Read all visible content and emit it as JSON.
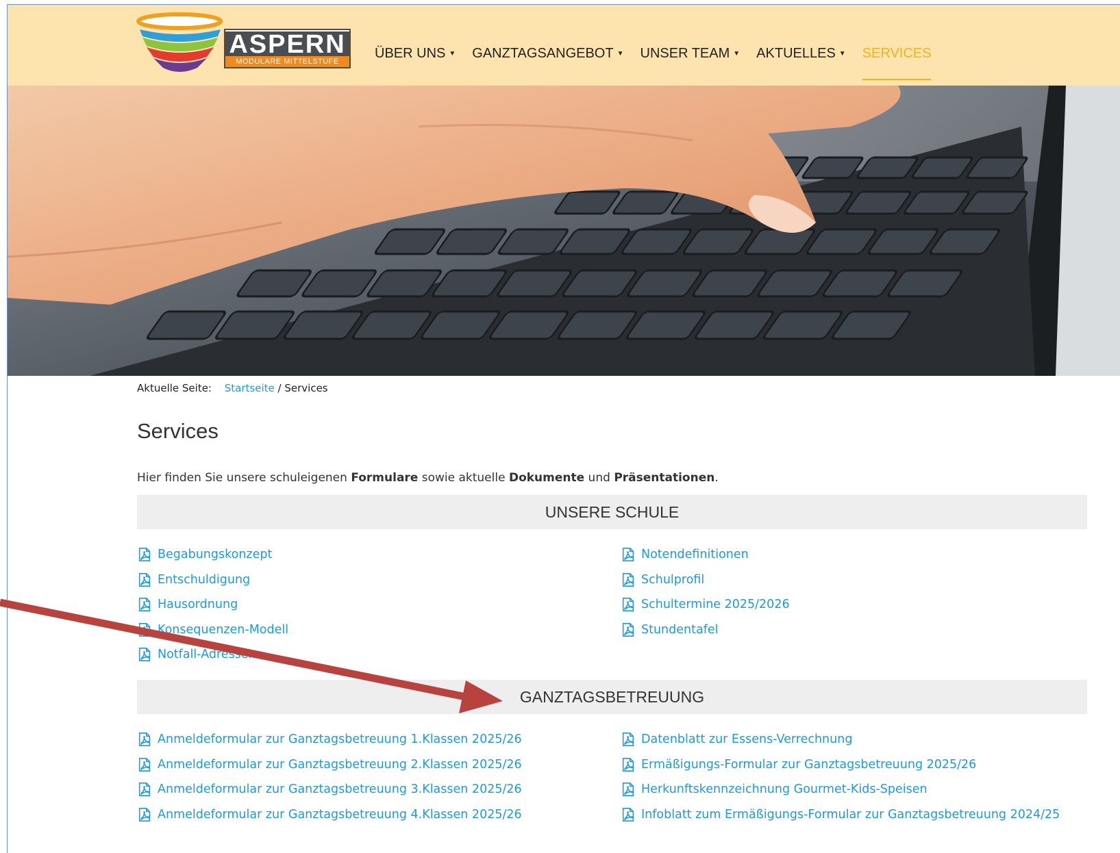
{
  "header": {
    "logo": {
      "word": "ASPERN",
      "subtitle": "MODULARE MITTELSTUFE"
    },
    "nav": [
      {
        "label": "ÜBER UNS",
        "dropdown": true
      },
      {
        "label": "GANZTAGSANGEBOT",
        "dropdown": true
      },
      {
        "label": "UNSER TEAM",
        "dropdown": true
      },
      {
        "label": "AKTUELLES",
        "dropdown": true
      },
      {
        "label": "SERVICES",
        "dropdown": false,
        "active": true
      }
    ]
  },
  "hero": {
    "icon": "keyboard-hand-photo"
  },
  "breadcrumb": {
    "prefix": "Aktuelle Seite:",
    "home": "Startseite",
    "separator": "/",
    "current": "Services"
  },
  "page": {
    "title": "Services",
    "intro": {
      "t1": "Hier finden Sie unsere schuleigenen ",
      "b1": "Formulare",
      "t2": " sowie aktuelle ",
      "b2": "Dokumente",
      "t3": " und ",
      "b3": "Präsentationen",
      "t4": "."
    }
  },
  "sections": {
    "schule": {
      "title": "UNSERE SCHULE",
      "left": [
        "Begabungskonzept",
        "Entschuldigung",
        "Hausordnung",
        "Konsequenzen-Modell",
        "Notfall-Adressen"
      ],
      "right": [
        "Notendefinitionen",
        "Schulprofil",
        "Schultermine 2025/2026",
        "Stundentafel"
      ]
    },
    "ganztag": {
      "title": "GANZTAGSBETREUUNG",
      "left": [
        "Anmeldeformular zur Ganztagsbetreuung 1.Klassen 2025/26",
        "Anmeldeformular zur Ganztagsbetreuung 2.Klassen 2025/26",
        "Anmeldeformular zur Ganztagsbetreuung 3.Klassen 2025/26",
        "Anmeldeformular zur Ganztagsbetreuung 4.Klassen 2025/26"
      ],
      "right": [
        "Datenblatt zur Essens-Verrechnung",
        "Ermäßigungs-Formular zur Ganztagsbetreuung 2025/26",
        "Herkunftskennzeichnung Gourmet-Kids-Speisen",
        "Infoblatt zum Ermäßigungs-Formular zur Ganztagsbetreuung 2024/25"
      ]
    }
  },
  "colors": {
    "header_bg": "#fde3ad",
    "nav_active": "#f5b31a",
    "link": "#1e9bd7",
    "section_bg": "#eeeeee",
    "annotation_arrow": "#b8433e"
  }
}
